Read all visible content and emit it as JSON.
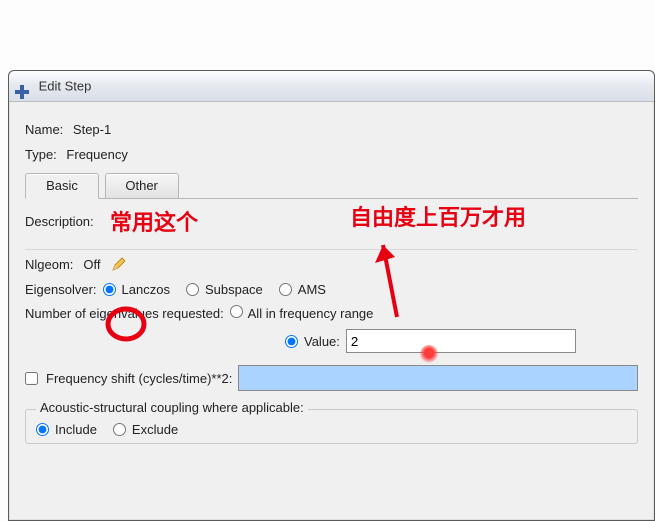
{
  "window": {
    "title": "Edit Step"
  },
  "fields": {
    "name_label": "Name:",
    "name_value": "Step-1",
    "type_label": "Type:",
    "type_value": "Frequency"
  },
  "tabs": {
    "basic": "Basic",
    "other": "Other"
  },
  "panel": {
    "description_label": "Description:",
    "description_value": "",
    "nlgeom_label": "Nlgeom:",
    "nlgeom_value": "Off",
    "eigensolver_label": "Eigensolver:",
    "eigensolver_options": {
      "lanczos": "Lanczos",
      "subspace": "Subspace",
      "ams": "AMS"
    },
    "num_eigen_label": "Number of eigenvalues requested:",
    "num_eigen_options": {
      "all": "All in frequency range",
      "value_label": "Value:"
    },
    "num_eigen_value": "2",
    "freq_shift_label": "Frequency shift (cycles/time)**2:",
    "freq_shift_value": "",
    "acoustic_group_title": "Acoustic-structural coupling where applicable:",
    "acoustic_options": {
      "include": "Include",
      "exclude": "Exclude"
    }
  },
  "annotations": {
    "common_this": "常用这个",
    "dof_million": "自由度上百万才用"
  }
}
